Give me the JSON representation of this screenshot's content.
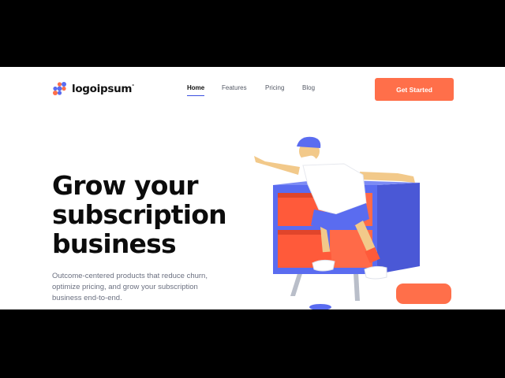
{
  "header": {
    "logo_text": "logoipsum",
    "logo_mark": "°",
    "nav": [
      {
        "label": "Home",
        "active": true
      },
      {
        "label": "Features",
        "active": false
      },
      {
        "label": "Pricing",
        "active": false
      },
      {
        "label": "Blog",
        "active": false
      }
    ],
    "cta_label": "Get Started"
  },
  "hero": {
    "title_lines": [
      "Grow your",
      "subscription",
      "business"
    ],
    "subtitle_lines": [
      "Outcome-centered products that reduce churn,",
      "optimize pricing, and grow your subscription",
      "business end-to-end."
    ],
    "illustration": "3d-character-jumping-off-shelf"
  },
  "colors": {
    "accent": "#ff6f4a",
    "nav_underline": "#3b4fe0",
    "shelf_blue": "#5a6cf0",
    "shelf_orange": "#ff5a3a",
    "title": "#0c0c0c"
  }
}
